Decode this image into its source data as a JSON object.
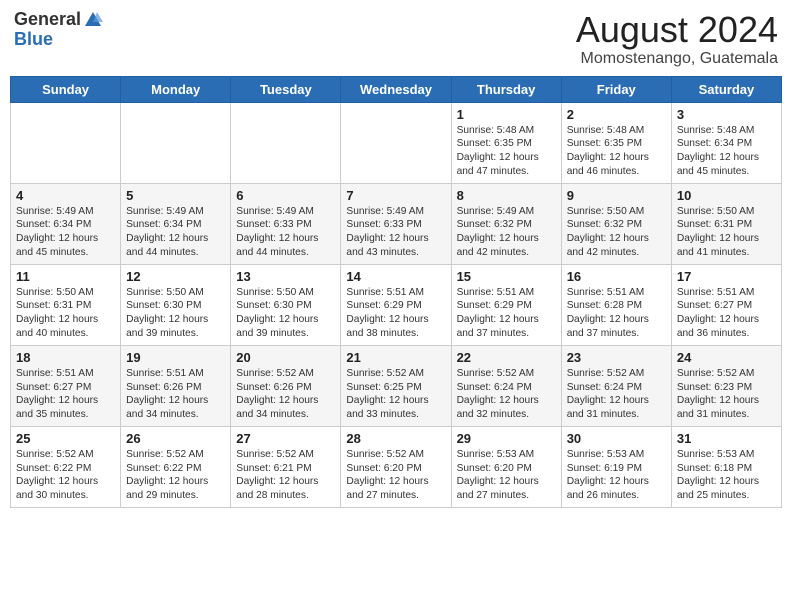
{
  "header": {
    "logo_general": "General",
    "logo_blue": "Blue",
    "month_year": "August 2024",
    "location": "Momostenango, Guatemala"
  },
  "weekdays": [
    "Sunday",
    "Monday",
    "Tuesday",
    "Wednesday",
    "Thursday",
    "Friday",
    "Saturday"
  ],
  "weeks": [
    [
      {
        "day": "",
        "info": ""
      },
      {
        "day": "",
        "info": ""
      },
      {
        "day": "",
        "info": ""
      },
      {
        "day": "",
        "info": ""
      },
      {
        "day": "1",
        "info": "Sunrise: 5:48 AM\nSunset: 6:35 PM\nDaylight: 12 hours\nand 47 minutes."
      },
      {
        "day": "2",
        "info": "Sunrise: 5:48 AM\nSunset: 6:35 PM\nDaylight: 12 hours\nand 46 minutes."
      },
      {
        "day": "3",
        "info": "Sunrise: 5:48 AM\nSunset: 6:34 PM\nDaylight: 12 hours\nand 45 minutes."
      }
    ],
    [
      {
        "day": "4",
        "info": "Sunrise: 5:49 AM\nSunset: 6:34 PM\nDaylight: 12 hours\nand 45 minutes."
      },
      {
        "day": "5",
        "info": "Sunrise: 5:49 AM\nSunset: 6:34 PM\nDaylight: 12 hours\nand 44 minutes."
      },
      {
        "day": "6",
        "info": "Sunrise: 5:49 AM\nSunset: 6:33 PM\nDaylight: 12 hours\nand 44 minutes."
      },
      {
        "day": "7",
        "info": "Sunrise: 5:49 AM\nSunset: 6:33 PM\nDaylight: 12 hours\nand 43 minutes."
      },
      {
        "day": "8",
        "info": "Sunrise: 5:49 AM\nSunset: 6:32 PM\nDaylight: 12 hours\nand 42 minutes."
      },
      {
        "day": "9",
        "info": "Sunrise: 5:50 AM\nSunset: 6:32 PM\nDaylight: 12 hours\nand 42 minutes."
      },
      {
        "day": "10",
        "info": "Sunrise: 5:50 AM\nSunset: 6:31 PM\nDaylight: 12 hours\nand 41 minutes."
      }
    ],
    [
      {
        "day": "11",
        "info": "Sunrise: 5:50 AM\nSunset: 6:31 PM\nDaylight: 12 hours\nand 40 minutes."
      },
      {
        "day": "12",
        "info": "Sunrise: 5:50 AM\nSunset: 6:30 PM\nDaylight: 12 hours\nand 39 minutes."
      },
      {
        "day": "13",
        "info": "Sunrise: 5:50 AM\nSunset: 6:30 PM\nDaylight: 12 hours\nand 39 minutes."
      },
      {
        "day": "14",
        "info": "Sunrise: 5:51 AM\nSunset: 6:29 PM\nDaylight: 12 hours\nand 38 minutes."
      },
      {
        "day": "15",
        "info": "Sunrise: 5:51 AM\nSunset: 6:29 PM\nDaylight: 12 hours\nand 37 minutes."
      },
      {
        "day": "16",
        "info": "Sunrise: 5:51 AM\nSunset: 6:28 PM\nDaylight: 12 hours\nand 37 minutes."
      },
      {
        "day": "17",
        "info": "Sunrise: 5:51 AM\nSunset: 6:27 PM\nDaylight: 12 hours\nand 36 minutes."
      }
    ],
    [
      {
        "day": "18",
        "info": "Sunrise: 5:51 AM\nSunset: 6:27 PM\nDaylight: 12 hours\nand 35 minutes."
      },
      {
        "day": "19",
        "info": "Sunrise: 5:51 AM\nSunset: 6:26 PM\nDaylight: 12 hours\nand 34 minutes."
      },
      {
        "day": "20",
        "info": "Sunrise: 5:52 AM\nSunset: 6:26 PM\nDaylight: 12 hours\nand 34 minutes."
      },
      {
        "day": "21",
        "info": "Sunrise: 5:52 AM\nSunset: 6:25 PM\nDaylight: 12 hours\nand 33 minutes."
      },
      {
        "day": "22",
        "info": "Sunrise: 5:52 AM\nSunset: 6:24 PM\nDaylight: 12 hours\nand 32 minutes."
      },
      {
        "day": "23",
        "info": "Sunrise: 5:52 AM\nSunset: 6:24 PM\nDaylight: 12 hours\nand 31 minutes."
      },
      {
        "day": "24",
        "info": "Sunrise: 5:52 AM\nSunset: 6:23 PM\nDaylight: 12 hours\nand 31 minutes."
      }
    ],
    [
      {
        "day": "25",
        "info": "Sunrise: 5:52 AM\nSunset: 6:22 PM\nDaylight: 12 hours\nand 30 minutes."
      },
      {
        "day": "26",
        "info": "Sunrise: 5:52 AM\nSunset: 6:22 PM\nDaylight: 12 hours\nand 29 minutes."
      },
      {
        "day": "27",
        "info": "Sunrise: 5:52 AM\nSunset: 6:21 PM\nDaylight: 12 hours\nand 28 minutes."
      },
      {
        "day": "28",
        "info": "Sunrise: 5:52 AM\nSunset: 6:20 PM\nDaylight: 12 hours\nand 27 minutes."
      },
      {
        "day": "29",
        "info": "Sunrise: 5:53 AM\nSunset: 6:20 PM\nDaylight: 12 hours\nand 27 minutes."
      },
      {
        "day": "30",
        "info": "Sunrise: 5:53 AM\nSunset: 6:19 PM\nDaylight: 12 hours\nand 26 minutes."
      },
      {
        "day": "31",
        "info": "Sunrise: 5:53 AM\nSunset: 6:18 PM\nDaylight: 12 hours\nand 25 minutes."
      }
    ]
  ]
}
